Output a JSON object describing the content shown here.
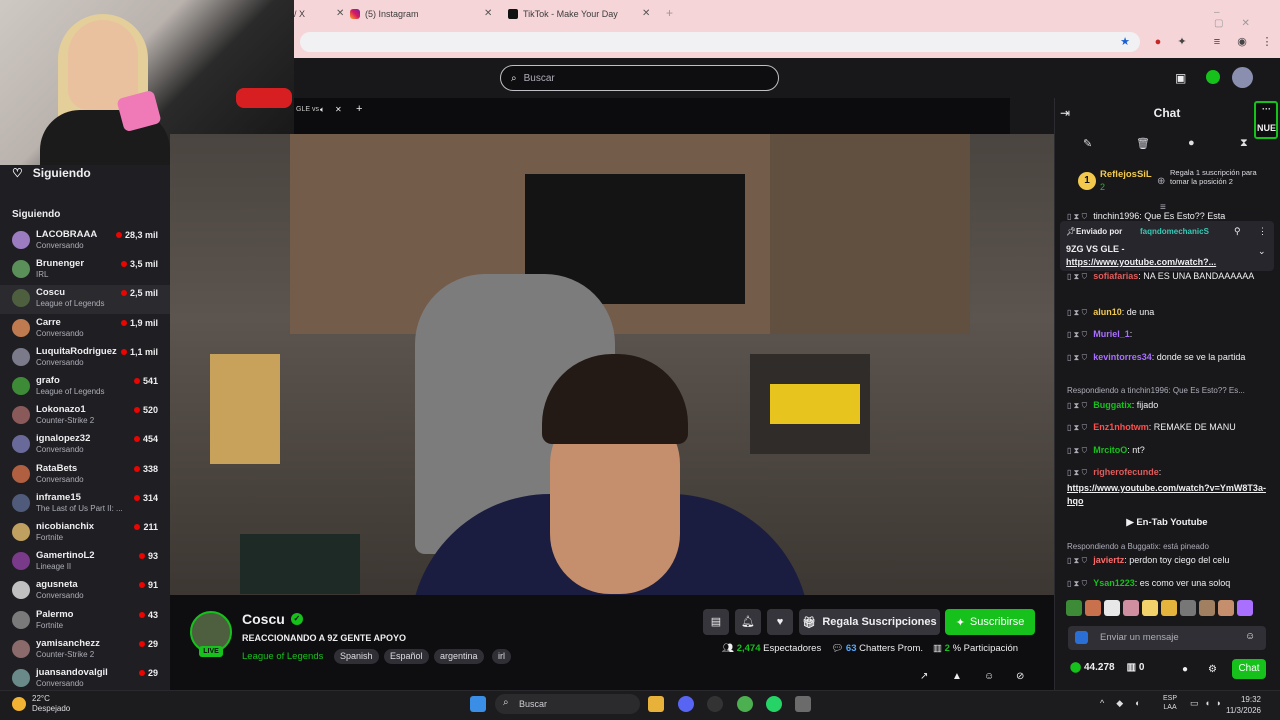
{
  "browser": {
    "tabs": [
      {
        "label": "/ X"
      },
      {
        "label": "(5) Instagram"
      },
      {
        "label": "TikTok - Make Your Day"
      }
    ],
    "new_tab": "+"
  },
  "search": {
    "placeholder": "Buscar"
  },
  "player": {
    "tab_label": "GLE vs"
  },
  "sidebar": {
    "heading": "Siguiendo",
    "subheading": "Siguiendo",
    "channels": [
      {
        "name": "LACOBRAAA",
        "game": "Conversando",
        "viewers": "28,3 mil"
      },
      {
        "name": "Brunenger",
        "game": "IRL",
        "viewers": "3,5 mil"
      },
      {
        "name": "Coscu",
        "game": "League of Legends",
        "viewers": "2,5 mil"
      },
      {
        "name": "Carre",
        "game": "Conversando",
        "viewers": "1,9 mil"
      },
      {
        "name": "LuquitaRodriguez",
        "game": "Conversando",
        "viewers": "1,1 mil"
      },
      {
        "name": "grafo",
        "game": "League of Legends",
        "viewers": "541"
      },
      {
        "name": "Lokonazo1",
        "game": "Counter-Strike 2",
        "viewers": "520"
      },
      {
        "name": "ignalopez32",
        "game": "Conversando",
        "viewers": "454"
      },
      {
        "name": "RataBets",
        "game": "Conversando",
        "viewers": "338"
      },
      {
        "name": "inframe15",
        "game": "The Last of Us Part II: ...",
        "viewers": "314"
      },
      {
        "name": "nicobianchix",
        "game": "Fortnite",
        "viewers": "211"
      },
      {
        "name": "GamertinoL2",
        "game": "Lineage II",
        "viewers": "93"
      },
      {
        "name": "agusneta",
        "game": "Conversando",
        "viewers": "91"
      },
      {
        "name": "Palermo",
        "game": "Fortnite",
        "viewers": "43"
      },
      {
        "name": "yamisanchezz",
        "game": "Counter-Strike 2",
        "viewers": "29"
      },
      {
        "name": "juansandovalgil",
        "game": "Conversando",
        "viewers": "29"
      }
    ]
  },
  "stream": {
    "channel": "Coscu",
    "live": "LIVE",
    "title": "REACCIONANDO A 9Z GENTE APOYO",
    "game": "League of Legends",
    "tags": [
      "Spanish",
      "Español",
      "argentina",
      "irl"
    ],
    "gift_label": "Regala Suscripciones",
    "subscribe_label": "Suscribirse",
    "viewers": "2,474",
    "viewers_label": "Espectadores",
    "chatters": "63",
    "chatters_label": "Chatters Prom.",
    "participation": "2",
    "participation_label": "% Participación"
  },
  "chat": {
    "title": "Chat",
    "new_label": "NUE",
    "leader_name": "ReflejosSiL",
    "leader_count": "2",
    "leader_rank": "1",
    "leader_cta": "Regala 1 suscripción para tomar la posición 2",
    "pinned_by_label": "Enviado por",
    "pinned_by_user": "faqndomechanicS",
    "pinned_text": "9ZG VS GLE -",
    "pinned_link": "https://www.youtube.com/watch?...",
    "partial_top": "tinchin1996: Que Es Esto?? Esta",
    "messages": [
      {
        "user": "sofiafarias",
        "text": ": NA ES UNA BANDAAAAAA",
        "color": "#e05b5b"
      },
      {
        "user": "alun10",
        "text": ": de una",
        "color": "#f2c94c"
      },
      {
        "user": "Muriel_1",
        "text": ":",
        "color": "#a970ff"
      },
      {
        "user": "kevintorres34",
        "text": ": donde se ve la partida",
        "color": "#a970ff"
      },
      {
        "user": "Buggatix",
        "text": ": fijado",
        "color": "#16c11b"
      },
      {
        "user": "Enz1nhotwm",
        "text": ": REMAKE DE MANU",
        "color": "#ff4f4f"
      },
      {
        "user": "MrcitoO",
        "text": ": nt?",
        "color": "#16c11b"
      },
      {
        "user": "righerofecunde",
        "text": ":",
        "color": "#e05b5b"
      },
      {
        "user": "javiertz",
        "text": ": perdon toy ciego del celu",
        "color": "#ff6b6b"
      },
      {
        "user": "Ysan1223",
        "text": ": es como ver una soloq",
        "color": "#16c11b"
      }
    ],
    "reply1": "Respondiendo a tinchin1996: Que Es Esto?? Es...",
    "reply2": "Respondiendo a Buggatix: está pineado",
    "link_msg": "https://www.youtube.com/watch?v=YmW8T3a-hqo",
    "yt_button": "En-Tab Youtube",
    "input_placeholder": "Enviar un mensaje",
    "points": "44.278",
    "zero": "0",
    "chat_button": "Chat"
  },
  "taskbar": {
    "temp": "22°C",
    "weather": "Despejado",
    "search": "Buscar",
    "lang1": "ESP",
    "lang2": "LAA",
    "time": "19:32",
    "date": "11/3/2026"
  }
}
